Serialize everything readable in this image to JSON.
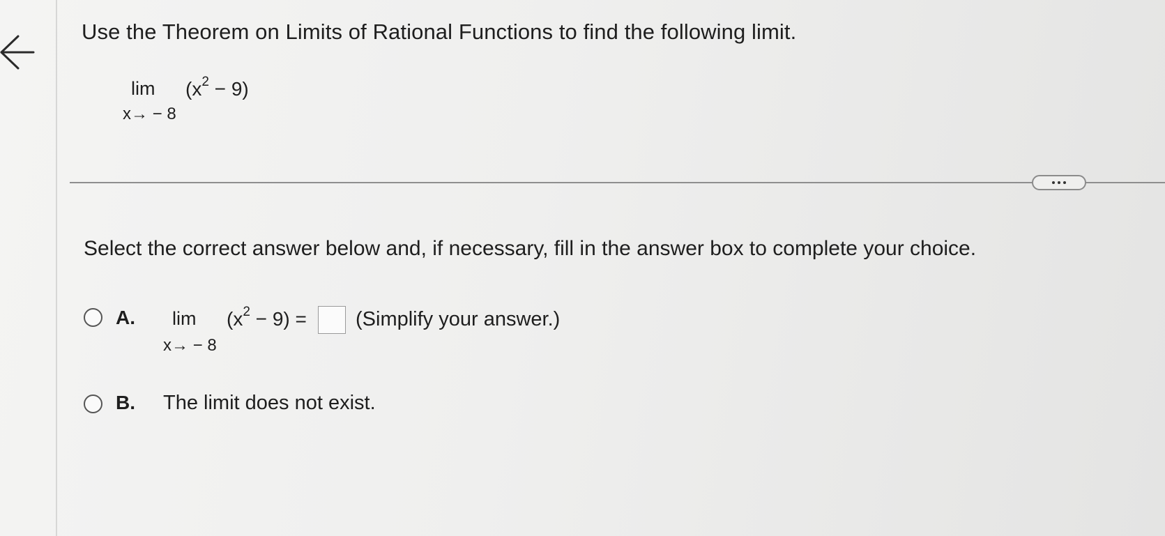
{
  "question": {
    "title": "Use the Theorem on Limits of Rational Functions to find the following limit.",
    "limit": {
      "lim": "lim",
      "approach": "x→ − 8",
      "base": "(x",
      "exponent": "2",
      "rest": " − 9)"
    }
  },
  "more_button": {
    "icon": "ellipsis-icon"
  },
  "instructions": "Select the correct answer below and, if necessary, fill in the answer box to complete your choice.",
  "options": [
    {
      "letter": "A.",
      "limit": {
        "lim": "lim",
        "approach": "x→ − 8",
        "base": "(x",
        "exponent": "2",
        "rest": " − 9) ="
      },
      "answer_value": "",
      "hint": "(Simplify your answer.)"
    },
    {
      "letter": "B.",
      "text": "The limit does not exist."
    }
  ],
  "nav": {
    "back_icon": "arrow-left-icon"
  }
}
